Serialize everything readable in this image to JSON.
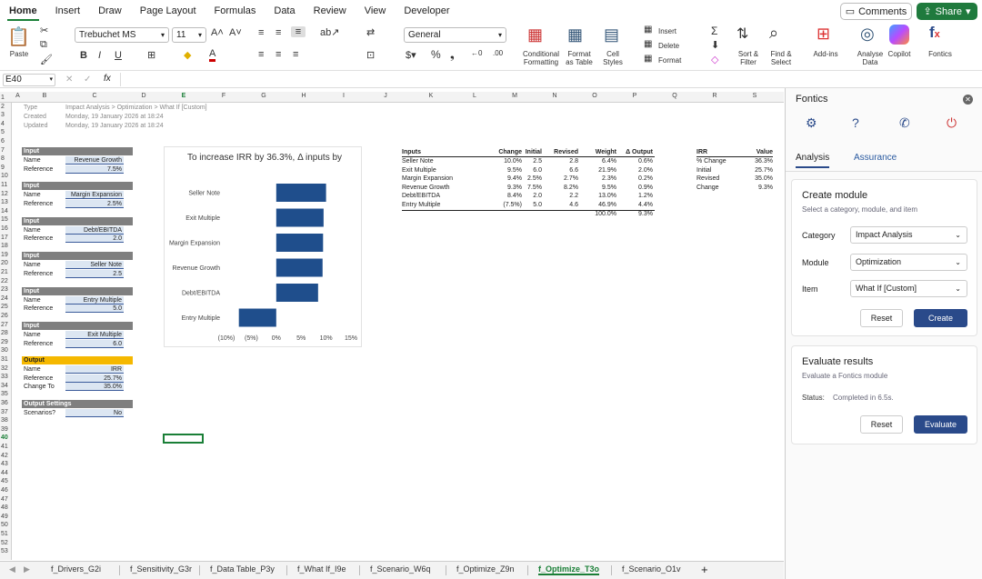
{
  "menu": {
    "tabs": [
      "Home",
      "Insert",
      "Draw",
      "Page Layout",
      "Formulas",
      "Data",
      "Review",
      "View",
      "Developer"
    ],
    "comments": "Comments",
    "share": "Share"
  },
  "ribbon": {
    "paste": "Paste",
    "font": "Trebuchet MS",
    "size": "11",
    "number_format": "General",
    "insert": "Insert",
    "delete": "Delete",
    "format": "Format",
    "cond1": "Conditional",
    "cond2": "Formatting",
    "fmt1": "Format",
    "fmt2": "as Table",
    "cell1": "Cell",
    "cell2": "Styles",
    "sort1": "Sort &",
    "sort2": "Filter",
    "find1": "Find &",
    "find2": "Select",
    "addins": "Add-ins",
    "analyse1": "Analyse",
    "analyse2": "Data",
    "copilot": "Copilot",
    "fontics": "Fontics"
  },
  "formula_bar": {
    "cell_ref": "E40",
    "fx": "fx",
    "value": ""
  },
  "columns": [
    "A",
    "B",
    "C",
    "D",
    "E",
    "F",
    "G",
    "H",
    "I",
    "J",
    "K",
    "L",
    "M",
    "N",
    "O",
    "P",
    "Q",
    "R",
    "S"
  ],
  "rows": [
    "1",
    "2",
    "3",
    "4",
    "5",
    "6",
    "7",
    "8",
    "9",
    "10",
    "11",
    "12",
    "13",
    "14",
    "15",
    "16",
    "17",
    "18",
    "19",
    "20",
    "21",
    "22",
    "23",
    "24",
    "25",
    "26",
    "27",
    "28",
    "29",
    "30",
    "31",
    "32",
    "33",
    "34",
    "35",
    "36",
    "37",
    "38",
    "39",
    "40",
    "41",
    "42",
    "43",
    "44",
    "45",
    "46",
    "47",
    "48",
    "49",
    "50",
    "51",
    "52",
    "53"
  ],
  "meta": {
    "type_label": "Type",
    "type_val": "Impact Analysis > Optimization > What If [Custom]",
    "created_label": "Created",
    "created_val": "Monday, 19 January 2026 at 18:24",
    "updated_label": "Updated",
    "updated_val": "Monday, 19 January 2026 at 18:24"
  },
  "input_blocks": [
    {
      "hdr": "Input",
      "name_label": "Name",
      "name": "Revenue Growth",
      "ref_label": "Reference",
      "ref": "7.5%"
    },
    {
      "hdr": "Input",
      "name_label": "Name",
      "name": "Margin Expansion",
      "ref_label": "Reference",
      "ref": "2.5%"
    },
    {
      "hdr": "Input",
      "name_label": "Name",
      "name": "Debt/EBITDA",
      "ref_label": "Reference",
      "ref": "2.0"
    },
    {
      "hdr": "Input",
      "name_label": "Name",
      "name": "Seller Note",
      "ref_label": "Reference",
      "ref": "2.5"
    },
    {
      "hdr": "Input",
      "name_label": "Name",
      "name": "Entry Multiple",
      "ref_label": "Reference",
      "ref": "5.0"
    },
    {
      "hdr": "Input",
      "name_label": "Name",
      "name": "Exit Multiple",
      "ref_label": "Reference",
      "ref": "6.0"
    }
  ],
  "output_block": {
    "hdr": "Output",
    "name_label": "Name",
    "name": "IRR",
    "ref_label": "Reference",
    "ref": "25.7%",
    "change_label": "Change To",
    "change": "35.0%"
  },
  "settings_block": {
    "hdr": "Output Settings",
    "label": "Scenarios?",
    "value": "No"
  },
  "chart_data": {
    "type": "bar",
    "orientation": "horizontal",
    "title": "To increase IRR by 36.3%, Δ inputs by",
    "categories": [
      "Seller Note",
      "Exit Multiple",
      "Margin Expansion",
      "Revenue Growth",
      "Debt/EBITDA",
      "Entry Multiple"
    ],
    "values": [
      10.0,
      9.5,
      9.4,
      9.3,
      8.4,
      -7.5
    ],
    "xlim": [
      -10,
      15
    ],
    "ticks": [
      -10,
      -5,
      0,
      5,
      10,
      15
    ],
    "tick_labels": [
      "(10%)",
      "(5%)",
      "0%",
      "5%",
      "10%",
      "15%"
    ],
    "bar_color": "#1f4e8c",
    "grid": false,
    "legend": "none"
  },
  "table": {
    "headers": [
      "Inputs",
      "Change",
      "Initial",
      "Revised",
      "Weight",
      "Δ Output"
    ],
    "rows": [
      [
        "Seller Note",
        "10.0%",
        "2.5",
        "2.8",
        "6.4%",
        "0.6%"
      ],
      [
        "Exit Multiple",
        "9.5%",
        "6.0",
        "6.6",
        "21.9%",
        "2.0%"
      ],
      [
        "Margin Expansion",
        "9.4%",
        "2.5%",
        "2.7%",
        "2.3%",
        "0.2%"
      ],
      [
        "Revenue Growth",
        "9.3%",
        "7.5%",
        "8.2%",
        "9.5%",
        "0.9%"
      ],
      [
        "Debt/EBITDA",
        "8.4%",
        "2.0",
        "2.2",
        "13.0%",
        "1.2%"
      ],
      [
        "Entry Multiple",
        "(7.5%)",
        "5.0",
        "4.6",
        "46.9%",
        "4.4%"
      ]
    ],
    "total_weight": "100.0%",
    "total_output": "9.3%"
  },
  "irr_table": {
    "headers": [
      "IRR",
      "Value"
    ],
    "rows": [
      [
        "% Change",
        "36.3%"
      ],
      [
        "Initial",
        "25.7%"
      ],
      [
        "Revised",
        "35.0%"
      ],
      [
        "Change",
        "9.3%"
      ]
    ]
  },
  "panel": {
    "title": "Fontics",
    "tabs": [
      "Analysis",
      "Assurance"
    ],
    "create": {
      "title": "Create module",
      "subtitle": "Select a category, module, and item",
      "category_label": "Category",
      "category": "Impact Analysis",
      "module_label": "Module",
      "module": "Optimization",
      "item_label": "Item",
      "item": "What If [Custom]",
      "reset": "Reset",
      "create": "Create"
    },
    "evaluate": {
      "title": "Evaluate results",
      "subtitle": "Evaluate a Fontics module",
      "status_label": "Status:",
      "status": "Completed in 6.5s.",
      "reset": "Reset",
      "evaluate": "Evaluate"
    }
  },
  "sheet_tabs": [
    "f_Drivers_G2i",
    "f_Sensitivity_G3r",
    "f_Data Table_P3y",
    "f_What If_I9e",
    "f_Scenario_W6q",
    "f_Optimize_Z9n",
    "f_Optimize_T3o",
    "f_Scenario_O1v"
  ],
  "active_sheet": "f_Optimize_T3o"
}
